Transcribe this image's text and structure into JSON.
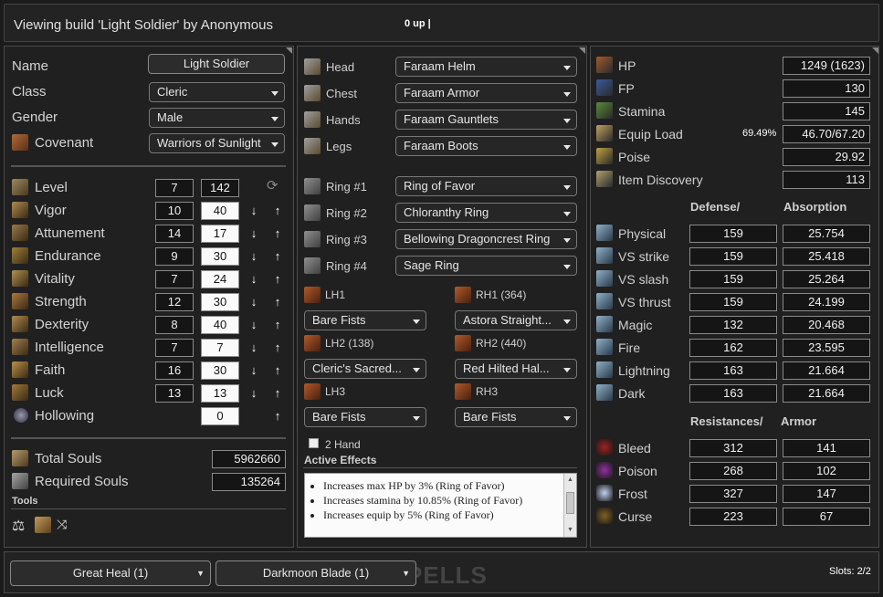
{
  "header": {
    "title": "Viewing build 'Light Soldier' by Anonymous",
    "status": "0 up |"
  },
  "profile": {
    "name_label": "Name",
    "name_value": "Light Soldier",
    "class_label": "Class",
    "class_value": "Cleric",
    "gender_label": "Gender",
    "gender_value": "Male",
    "covenant_label": "Covenant",
    "covenant_value": "Warriors of Sunlight"
  },
  "stats": {
    "level_label": "Level",
    "level_base": "7",
    "level_value": "142",
    "rows": [
      {
        "label": "Vigor",
        "base": "10",
        "value": "40"
      },
      {
        "label": "Attunement",
        "base": "14",
        "value": "17"
      },
      {
        "label": "Endurance",
        "base": "9",
        "value": "30"
      },
      {
        "label": "Vitality",
        "base": "7",
        "value": "24"
      },
      {
        "label": "Strength",
        "base": "12",
        "value": "30"
      },
      {
        "label": "Dexterity",
        "base": "8",
        "value": "40"
      },
      {
        "label": "Intelligence",
        "base": "7",
        "value": "7"
      },
      {
        "label": "Faith",
        "base": "16",
        "value": "30"
      },
      {
        "label": "Luck",
        "base": "13",
        "value": "13"
      },
      {
        "label": "Hollowing",
        "base": "",
        "value": "0"
      }
    ]
  },
  "souls": {
    "total_label": "Total Souls",
    "total_value": "5962660",
    "required_label": "Required Souls",
    "required_value": "135264"
  },
  "tools": {
    "label": "Tools"
  },
  "armor": [
    {
      "label": "Head",
      "value": "Faraam Helm"
    },
    {
      "label": "Chest",
      "value": "Faraam Armor"
    },
    {
      "label": "Hands",
      "value": "Faraam Gauntlets"
    },
    {
      "label": "Legs",
      "value": "Faraam Boots"
    }
  ],
  "rings": [
    {
      "label": "Ring #1",
      "value": "Ring of Favor"
    },
    {
      "label": "Ring #2",
      "value": "Chloranthy Ring"
    },
    {
      "label": "Ring #3",
      "value": "Bellowing Dragoncrest Ring"
    },
    {
      "label": "Ring #4",
      "value": "Sage Ring"
    }
  ],
  "weapons": {
    "lh1_label": "LH1",
    "lh1_value": "Bare Fists",
    "rh1_label": "RH1 (364)",
    "rh1_value": "Astora Straight...",
    "lh2_label": "LH2 (138)",
    "lh2_value": "Cleric's Sacred...",
    "rh2_label": "RH2 (440)",
    "rh2_value": "Red Hilted Hal...",
    "lh3_label": "LH3",
    "lh3_value": "Bare Fists",
    "rh3_label": "RH3",
    "rh3_value": "Bare Fists",
    "two_hand_label": "2 Hand"
  },
  "effects": {
    "label": "Active Effects",
    "items": [
      "Increases max HP by 3% (Ring of Favor)",
      "Increases stamina by 10.85% (Ring of Favor)",
      "Increases equip by 5% (Ring of Favor)"
    ]
  },
  "vitals": [
    {
      "label": "HP",
      "value": "1249 (1623)"
    },
    {
      "label": "FP",
      "value": "130"
    },
    {
      "label": "Stamina",
      "value": "145"
    },
    {
      "label": "Equip Load",
      "value": "46.70/67.20",
      "extra": "69.49%"
    },
    {
      "label": "Poise",
      "value": "29.92"
    },
    {
      "label": "Item Discovery",
      "value": "113"
    }
  ],
  "defense": {
    "col1": "Defense/",
    "col2": "Absorption",
    "rows": [
      {
        "label": "Physical",
        "def": "159",
        "abs": "25.754"
      },
      {
        "label": "VS strike",
        "def": "159",
        "abs": "25.418"
      },
      {
        "label": "VS slash",
        "def": "159",
        "abs": "25.264"
      },
      {
        "label": "VS thrust",
        "def": "159",
        "abs": "24.199"
      },
      {
        "label": "Magic",
        "def": "132",
        "abs": "20.468"
      },
      {
        "label": "Fire",
        "def": "162",
        "abs": "23.595"
      },
      {
        "label": "Lightning",
        "def": "163",
        "abs": "21.664"
      },
      {
        "label": "Dark",
        "def": "163",
        "abs": "21.664"
      }
    ]
  },
  "resist": {
    "col1": "Resistances/",
    "col2": "Armor",
    "rows": [
      {
        "label": "Bleed",
        "res": "312",
        "arm": "141"
      },
      {
        "label": "Poison",
        "res": "268",
        "arm": "102"
      },
      {
        "label": "Frost",
        "res": "327",
        "arm": "147"
      },
      {
        "label": "Curse",
        "res": "223",
        "arm": "67"
      }
    ]
  },
  "spells": {
    "slot1": "Great Heal (1)",
    "slot2": "Darkmoon Blade (1)",
    "watermark": "PELLS",
    "slots": "Slots: 2/2"
  }
}
